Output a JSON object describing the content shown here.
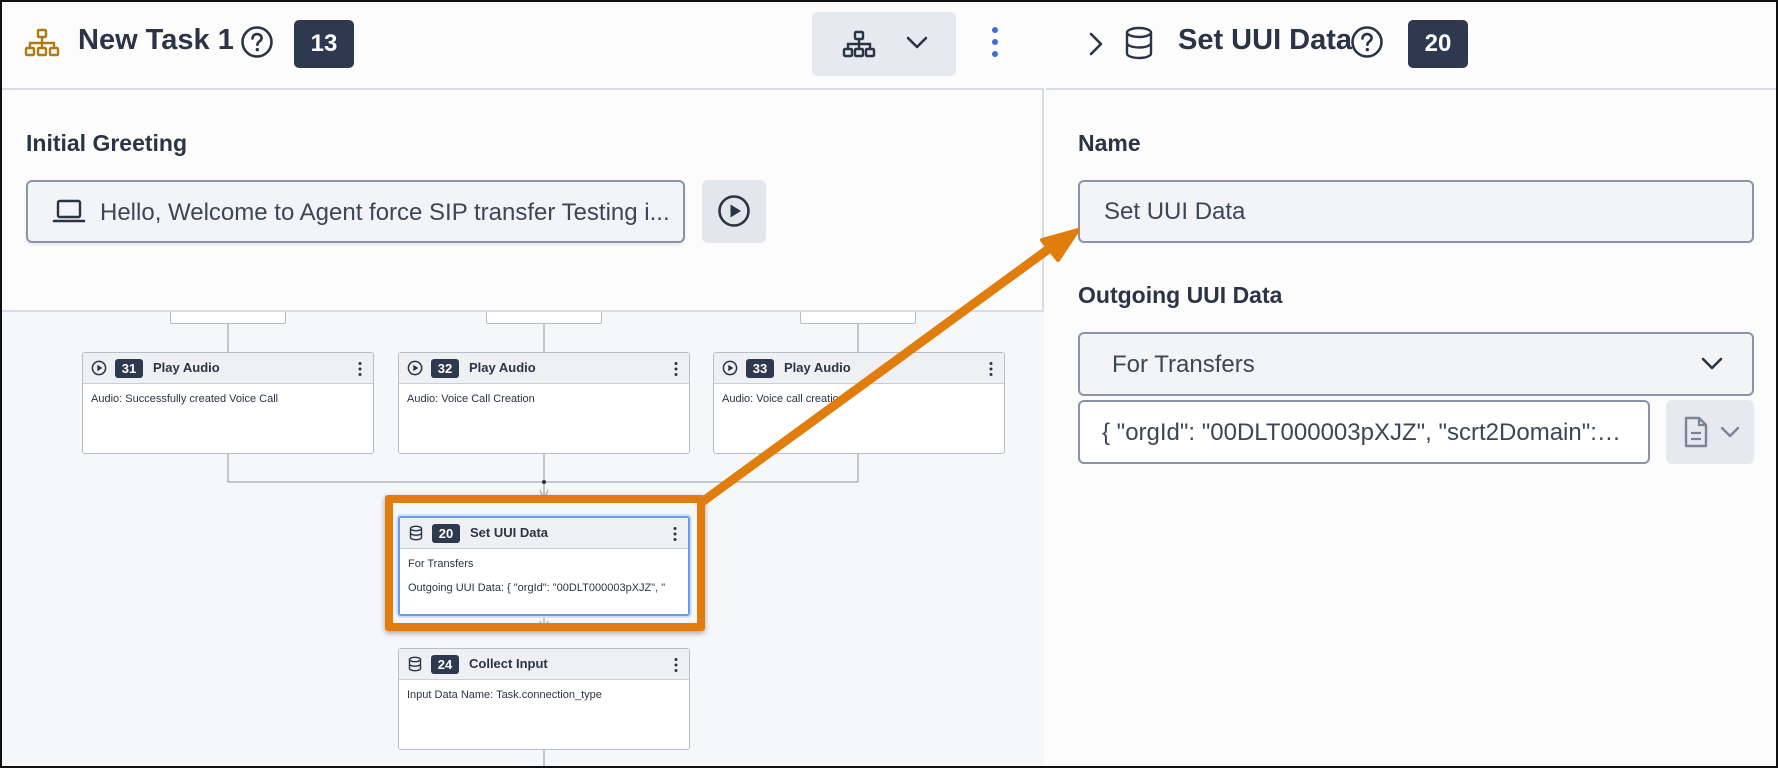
{
  "left_panel": {
    "task_title": "New Task 1",
    "task_badge": "13",
    "initial_greeting_label": "Initial Greeting",
    "greeting_value": "Hello, Welcome to Agent force SIP transfer Testing i...",
    "icons": [
      "hierarchy-icon",
      "help-circle-icon",
      "chevron-down-icon",
      "more-vertical-icon",
      "laptop-icon",
      "play-circle-icon"
    ]
  },
  "canvas": {
    "nodes": [
      {
        "num": "31",
        "title": "Play Audio",
        "line1": "Audio: Successfully created Voice Call",
        "icon": "play-icon"
      },
      {
        "num": "32",
        "title": "Play Audio",
        "line1": "Audio: Voice Call Creation",
        "icon": "play-icon"
      },
      {
        "num": "33",
        "title": "Play Audio",
        "line1": "Audio: Voice call creatio",
        "icon": "play-icon"
      },
      {
        "num": "20",
        "title": "Set UUI Data",
        "line1": "For Transfers",
        "line2": "Outgoing UUI Data: { \"orgId\": \"00DLT000003pXJZ\", \"",
        "icon": "database-icon"
      },
      {
        "num": "24",
        "title": "Collect Input",
        "line1": "Input Data Name: Task.connection_type",
        "icon": "database-icon"
      }
    ]
  },
  "right_panel": {
    "title": "Set UUI Data",
    "badge": "20",
    "name_label": "Name",
    "name_value": "Set UUI Data",
    "uui_label": "Outgoing UUI Data",
    "select_value": "For Transfers",
    "json_value": "{ \"orgId\": \"00DLT000003pXJZ\", \"scrt2Domain\": \"o...",
    "icons": [
      "chevron-right-icon",
      "database-icon",
      "help-circle-icon",
      "document-icon",
      "chevron-down-icon"
    ]
  },
  "colors": {
    "accent_orange": "#e07d0c",
    "badge_bg": "#2e3950",
    "selected_node_border": "#6b9be8"
  }
}
